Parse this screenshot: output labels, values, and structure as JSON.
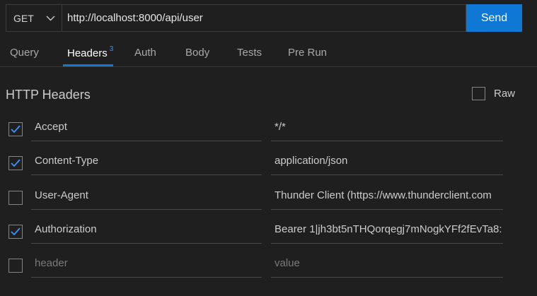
{
  "request": {
    "method": "GET",
    "url": "http://localhost:8000/api/user",
    "send_label": "Send"
  },
  "tabs": [
    {
      "label": "Query"
    },
    {
      "label": "Headers",
      "badge": "3",
      "active": true
    },
    {
      "label": "Auth"
    },
    {
      "label": "Body"
    },
    {
      "label": "Tests"
    },
    {
      "label": "Pre Run"
    }
  ],
  "headers_section": {
    "title": "HTTP Headers",
    "raw_label": "Raw",
    "raw_checked": false
  },
  "headers": [
    {
      "checked": true,
      "key": "Accept",
      "value": "*/*"
    },
    {
      "checked": true,
      "key": "Content-Type",
      "value": "application/json"
    },
    {
      "checked": false,
      "key": "User-Agent",
      "value": "Thunder Client (https://www.thunderclient.com"
    },
    {
      "checked": true,
      "key": "Authorization",
      "value": "Bearer 1|jh3bt5nTHQorqegj7mNogkYFf2fEvTa8:"
    }
  ],
  "new_header": {
    "checked": false,
    "key_placeholder": "header",
    "value_placeholder": "value"
  },
  "colors": {
    "accent": "#0e78d4",
    "checkmark": "#3794ff",
    "background": "#1f1f1f"
  }
}
